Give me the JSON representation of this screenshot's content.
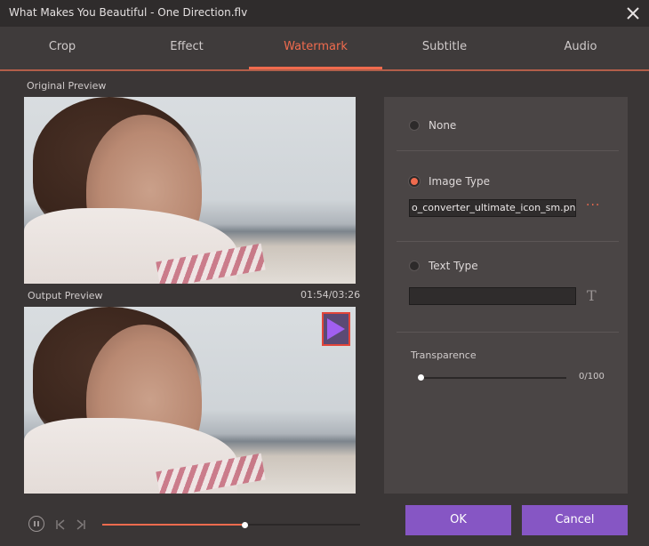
{
  "window": {
    "title": "What Makes You Beautiful - One Direction.flv"
  },
  "tabs": [
    {
      "label": "Crop",
      "active": false
    },
    {
      "label": "Effect",
      "active": false
    },
    {
      "label": "Watermark",
      "active": true
    },
    {
      "label": "Subtitle",
      "active": false
    },
    {
      "label": "Audio",
      "active": false
    }
  ],
  "preview": {
    "original_label": "Original Preview",
    "output_label": "Output Preview",
    "timecode": "01:54/03:26"
  },
  "watermark": {
    "none_label": "None",
    "image_type_label": "Image Type",
    "image_file_value": "o_converter_ultimate_icon_sm.png",
    "browse_label": "···",
    "text_type_label": "Text Type",
    "text_value": "",
    "selected": "image",
    "transparence_label": "Transparence",
    "transparence_value": "0/100",
    "transparence_fraction": 0.0
  },
  "playback": {
    "progress_fraction": 0.55
  },
  "buttons": {
    "ok_label": "OK",
    "cancel_label": "Cancel"
  },
  "icons": {
    "close": "close-icon",
    "pause": "pause-icon",
    "prev": "previous-frame-icon",
    "next": "next-frame-icon",
    "text": "text-style-icon",
    "browse": "more-icon"
  },
  "colors": {
    "accent": "#f06b4e",
    "button": "#8656c4",
    "background": "#3a3636",
    "panel": "#4a4545"
  }
}
